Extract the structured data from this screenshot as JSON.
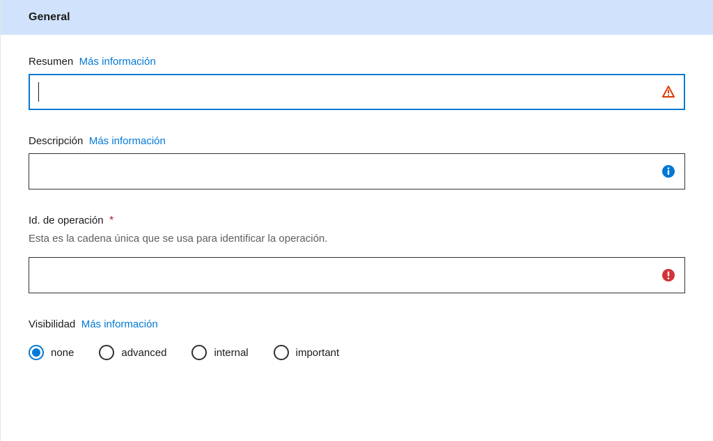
{
  "section": {
    "title": "General"
  },
  "fields": {
    "summary": {
      "label": "Resumen",
      "learn_more": "Más información",
      "value": "",
      "status": "warning"
    },
    "description": {
      "label": "Descripción",
      "learn_more": "Más información",
      "value": "",
      "status": "info"
    },
    "operation_id": {
      "label": "Id. de operación",
      "required": true,
      "helper": "Esta es la cadena única que se usa para identificar la operación.",
      "value": "",
      "status": "error"
    },
    "visibility": {
      "label": "Visibilidad",
      "learn_more": "Más información",
      "selected": "none",
      "options": {
        "none": "none",
        "advanced": "advanced",
        "internal": "internal",
        "important": "important"
      }
    }
  }
}
